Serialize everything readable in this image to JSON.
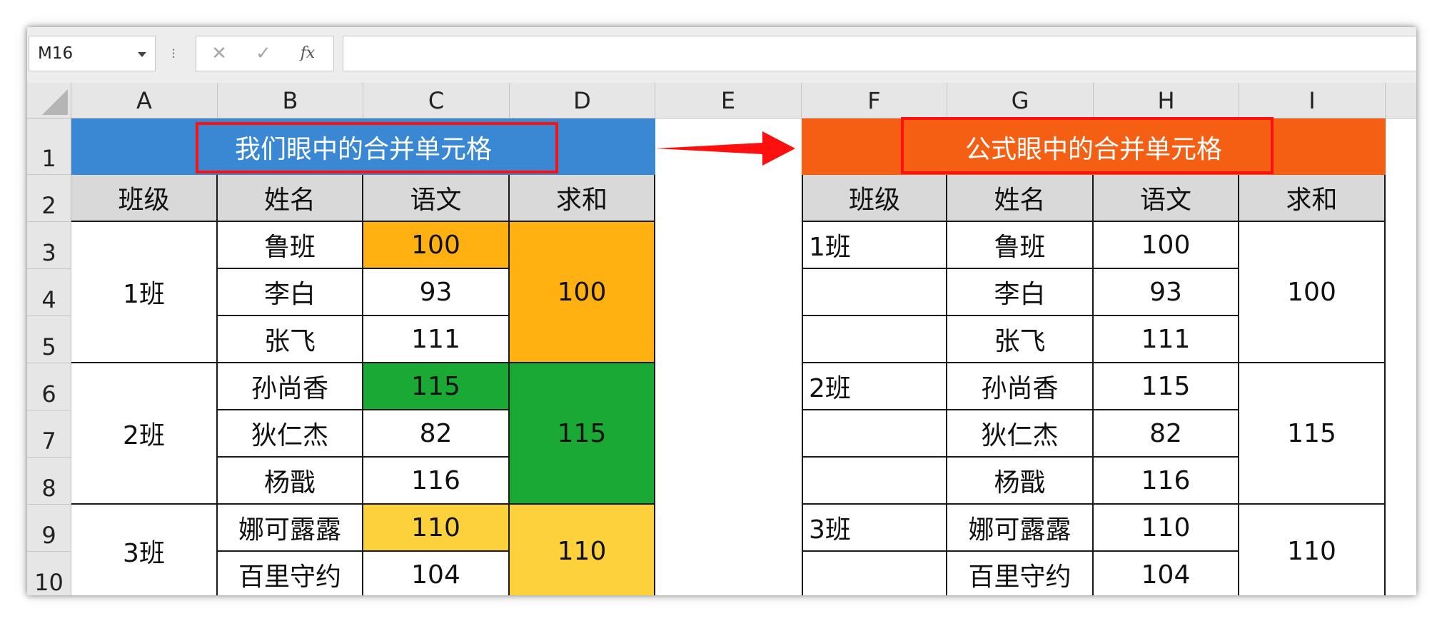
{
  "formula_bar": {
    "name_box": "M16",
    "cancel_icon": "✕",
    "enter_icon": "✓",
    "fx_label": "fx",
    "formula": ""
  },
  "columns": [
    "A",
    "B",
    "C",
    "D",
    "E",
    "F",
    "G",
    "H",
    "I"
  ],
  "rows": [
    "1",
    "2",
    "3",
    "4",
    "5",
    "6",
    "7",
    "8",
    "9",
    "10"
  ],
  "left_table": {
    "title": "我们眼中的合并单元格",
    "headers": [
      "班级",
      "姓名",
      "语文",
      "求和"
    ],
    "classes": [
      "1班",
      "2班",
      "3班"
    ],
    "names": [
      "鲁班",
      "李白",
      "张飞",
      "孙尚香",
      "狄仁杰",
      "杨戬",
      "娜可露露",
      "百里守约"
    ],
    "scores": [
      "100",
      "93",
      "111",
      "115",
      "82",
      "116",
      "110",
      "104"
    ],
    "sums": [
      "100",
      "115",
      "110"
    ]
  },
  "right_table": {
    "title": "公式眼中的合并单元格",
    "headers": [
      "班级",
      "姓名",
      "语文",
      "求和"
    ],
    "classes": [
      "1班",
      "2班",
      "3班"
    ],
    "names": [
      "鲁班",
      "李白",
      "张飞",
      "孙尚香",
      "狄仁杰",
      "杨戬",
      "娜可露露",
      "百里守约"
    ],
    "scores": [
      "100",
      "93",
      "111",
      "115",
      "82",
      "116",
      "110",
      "104"
    ],
    "sums": [
      "100",
      "115",
      "110"
    ]
  },
  "colors": {
    "left_title_bg": "#3a88d3",
    "right_title_bg": "#f55f14",
    "header_bg": "#d9d9d9",
    "group1_fill": "#feb111",
    "group2_fill": "#1aa934",
    "group3_fill": "#fdd13c",
    "highlight_border": "#ff1010",
    "arrow": "#ff1010"
  },
  "icons": [
    "name-box-dropdown-icon",
    "cancel-icon",
    "enter-icon",
    "insert-function-icon",
    "select-all-triangle-icon",
    "right-arrow-icon"
  ]
}
